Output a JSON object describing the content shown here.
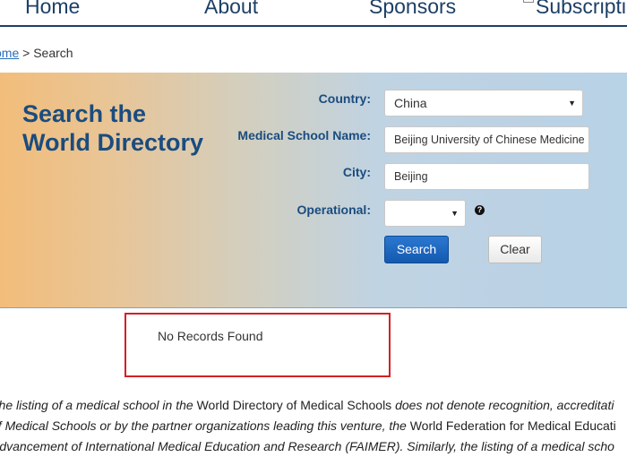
{
  "nav": {
    "home": "Home",
    "about": "About",
    "sponsors": "Sponsors",
    "subscriptions": "Subscriptio"
  },
  "breadcrumb": {
    "home": "ome",
    "separator": " > ",
    "current": "Search"
  },
  "search_panel": {
    "title_line1": "Search the",
    "title_line2": "World Directory",
    "country_label": "Country:",
    "country_value": "China",
    "school_label": "Medical School Name:",
    "school_value": "Beijing University of Chinese Medicine",
    "city_label": "City:",
    "city_value": "Beijing",
    "operational_label": "Operational:",
    "operational_value": "",
    "help_icon": "question-icon",
    "search_button": "Search",
    "clear_button": "Clear"
  },
  "results": {
    "message": "No Records Found"
  },
  "disclaimer": {
    "line1_a": "The listing of a medical school in the ",
    "line1_b": "World Directory of Medical Schools",
    "line1_c": " does not denote recognition, accreditati",
    "line2_a": "of Medical Schools or by the partner organizations leading this venture, the ",
    "line2_b": "World Federation for Medical Educati",
    "line3_a": "Advancement of International Medical Education and Research (FAIMER). Similarly, the listing of a medical scho"
  },
  "colors": {
    "brand_blue": "#1a4c7f",
    "search_button": "#1459b0",
    "highlight_red": "#d51f26"
  }
}
